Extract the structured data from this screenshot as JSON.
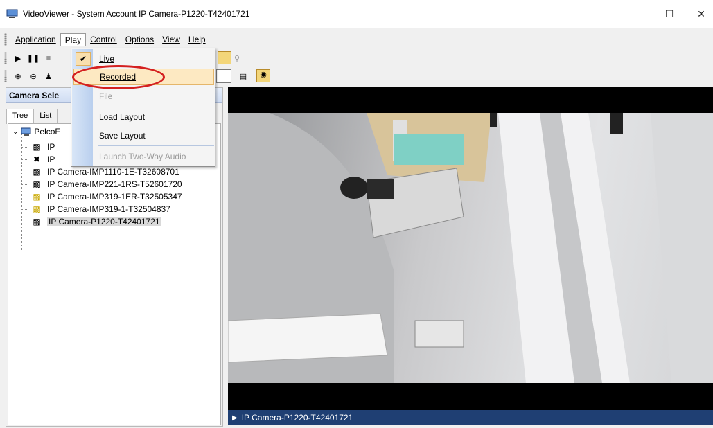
{
  "window": {
    "title": "VideoViewer - System Account IP Camera-P1220-T42401721",
    "min_glyph": "—",
    "max_glyph": "☐",
    "close_glyph": "✕"
  },
  "menubar": {
    "items": [
      "Application",
      "Play",
      "Control",
      "Options",
      "View",
      "Help"
    ]
  },
  "panel": {
    "title": "Camera Sele",
    "tabs": [
      "Tree",
      "List"
    ]
  },
  "tree": {
    "root": "PelcoF",
    "nodes": [
      "IP",
      "IP",
      "IP Camera-IMP1110-1E-T32608701",
      "IP Camera-IMP221-1RS-T52601720",
      "IP Camera-IMP319-1ER-T32505347",
      "IP Camera-IMP319-1-T32504837",
      "IP Camera-P1220-T42401721"
    ]
  },
  "play_menu": {
    "items": [
      "Live",
      "Recorded",
      "File",
      "Load Layout",
      "Save Layout",
      "Launch Two-Way Audio"
    ]
  },
  "video": {
    "camera_label": "IP Camera-P1220-T42401721"
  },
  "colors": {
    "highlight": "#fde9c2",
    "status_bar": "#1f3f73",
    "annotation": "#d42020"
  }
}
